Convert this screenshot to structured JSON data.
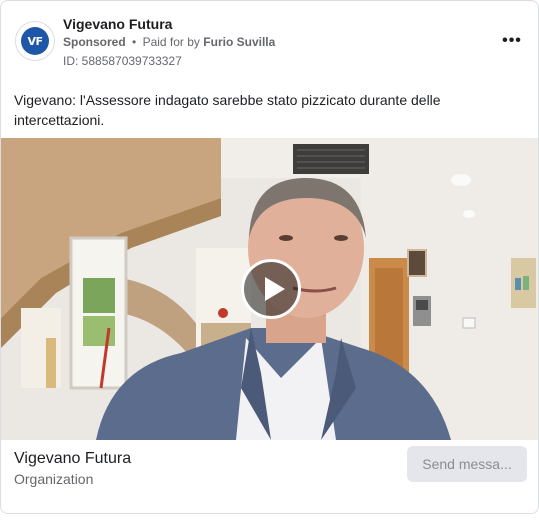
{
  "header": {
    "page_name": "Vigevano Futura",
    "avatar_text": "VF",
    "sponsored_label": "Sponsored",
    "separator": "•",
    "paid_for_label": "Paid for by",
    "payer_name": "Furio Suvilla",
    "ad_id": "ID: 588587039733327",
    "more_icon": "more-horizontal-icon",
    "more_label": "•••"
  },
  "body": {
    "text": "Vigevano: l'Assessore indagato sarebbe stato pizzicato durante delle intercettazioni."
  },
  "video": {
    "play_icon": "play-icon"
  },
  "footer": {
    "title": "Vigevano Futura",
    "subtitle": "Organization",
    "cta_label": "Send messa..."
  },
  "colors": {
    "avatar_blue": "#1f57a8",
    "secondary_text": "#65676b",
    "cta_background": "#e4e6eb"
  }
}
